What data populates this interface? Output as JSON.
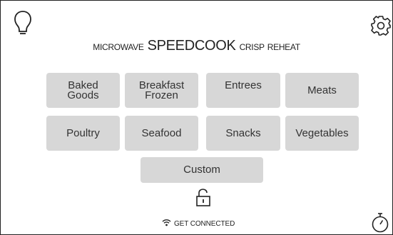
{
  "header": {
    "icons": {
      "light": "lightbulb-icon",
      "settings": "gear-icon",
      "timer": "stopwatch-icon"
    }
  },
  "modes": [
    {
      "label": "MICROWAVE",
      "active": false
    },
    {
      "label": "SPEEDCOOK",
      "active": true
    },
    {
      "label": "CRISP",
      "active": false
    },
    {
      "label": "REHEAT",
      "active": false
    }
  ],
  "categories": {
    "baked_goods": "Baked\nGoods",
    "breakfast_frozen": "Breakfast\nFrozen",
    "entrees": "Entrees",
    "meats": "Meats",
    "poultry": "Poultry",
    "seafood": "Seafood",
    "snacks": "Snacks",
    "vegetables": "Vegetables",
    "custom": "Custom"
  },
  "lock": {
    "icon": "unlock-icon"
  },
  "footer": {
    "connect_label": "GET CONNECTED",
    "connect_icon": "wifi-icon"
  },
  "colors": {
    "button_bg": "#d7d7d7",
    "text": "#222222",
    "background": "#ffffff"
  }
}
